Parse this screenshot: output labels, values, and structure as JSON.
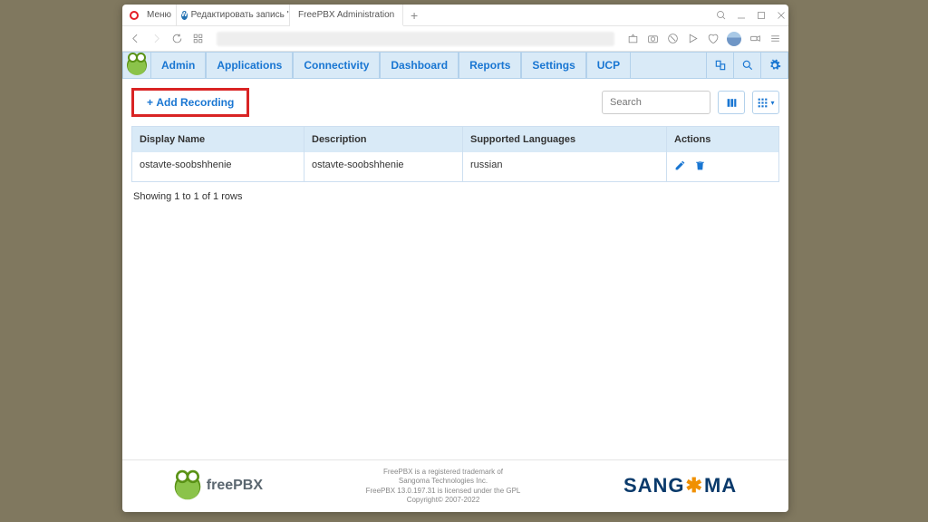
{
  "browser": {
    "tabs": [
      {
        "label": "Меню"
      },
      {
        "label": "Редактировать запись \"К..."
      },
      {
        "label": "FreePBX Administration"
      }
    ]
  },
  "nav": {
    "items": [
      "Admin",
      "Applications",
      "Connectivity",
      "Dashboard",
      "Reports",
      "Settings",
      "UCP"
    ]
  },
  "toolbar": {
    "add_label": "Add Recording",
    "search_placeholder": "Search"
  },
  "table": {
    "headers": {
      "display": "Display Name",
      "desc": "Description",
      "lang": "Supported Languages",
      "actions": "Actions"
    },
    "rows": [
      {
        "display": "ostavte-soobshhenie",
        "desc": "ostavte-soobshhenie",
        "lang": "russian"
      }
    ],
    "summary": "Showing 1 to 1 of 1 rows"
  },
  "footer": {
    "line1": "FreePBX is a registered trademark of",
    "line2": "Sangoma Technologies Inc.",
    "line3": "FreePBX 13.0.197.31 is licensed under the GPL",
    "line4": "Copyright© 2007-2022",
    "logo_text": "freePBX",
    "sangoma": "SANG",
    "sangoma2": "MA"
  }
}
